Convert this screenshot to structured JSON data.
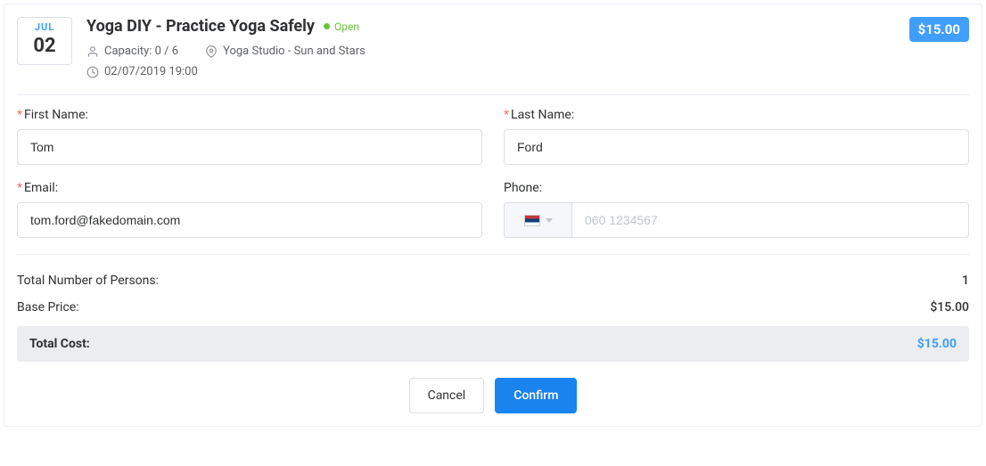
{
  "date": {
    "month": "JUL",
    "day": "02"
  },
  "header": {
    "title": "Yoga DIY - Practice Yoga Safely",
    "status": "Open",
    "capacity": "Capacity: 0 / 6",
    "location": "Yoga Studio - Sun and Stars",
    "datetime": "02/07/2019 19:00",
    "price": "$15.00"
  },
  "form": {
    "first_name": {
      "label": "First Name:",
      "value": "Tom"
    },
    "last_name": {
      "label": "Last Name:",
      "value": "Ford"
    },
    "email": {
      "label": "Email:",
      "value": "tom.ford@fakedomain.com"
    },
    "phone": {
      "label": "Phone:",
      "placeholder": "060 1234567",
      "value": ""
    }
  },
  "summary": {
    "persons_label": "Total Number of Persons:",
    "persons_value": "1",
    "base_label": "Base Price:",
    "base_value": "$15.00",
    "total_label": "Total Cost:",
    "total_value": "$15.00"
  },
  "actions": {
    "cancel": "Cancel",
    "confirm": "Confirm"
  }
}
